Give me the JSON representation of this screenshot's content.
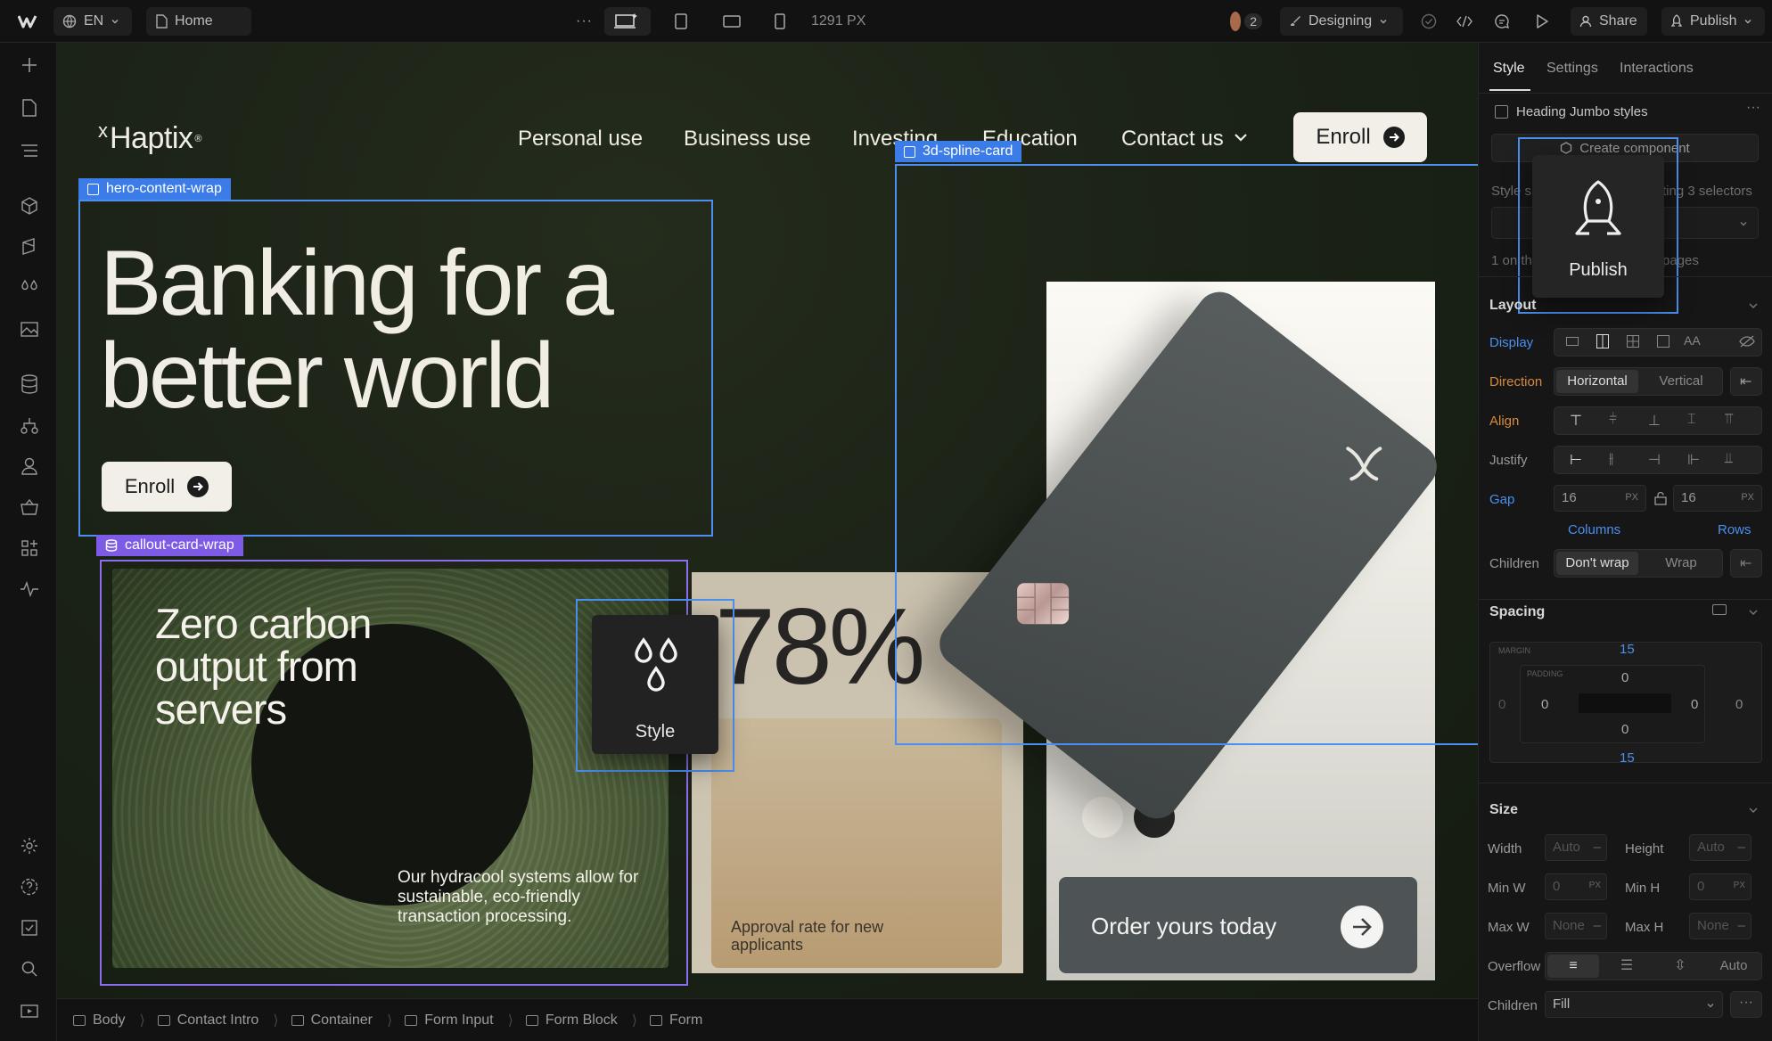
{
  "topbar": {
    "locale": "EN",
    "page": "Home",
    "width_readout": "1291 PX",
    "collaborators": "2",
    "mode": "Designing",
    "share": "Share",
    "publish": "Publish"
  },
  "panel": {
    "tabs": [
      "Style",
      "Settings",
      "Interactions"
    ],
    "style_header": "Heading Jumbo styles",
    "create_component": "Create component",
    "selector_note_left": "Style s",
    "selector_note_right": "ting 3 selectors",
    "on_pages_left": "1 on th",
    "on_pages_right": "pages",
    "publish_popup": "Publish",
    "layout": {
      "title": "Layout",
      "display": "Display",
      "direction": "Direction",
      "dir_h": "Horizontal",
      "dir_v": "Vertical",
      "align": "Align",
      "justify": "Justify",
      "gap": "Gap",
      "gap_col": "16",
      "gap_row": "16",
      "gap_unit": "PX",
      "columns": "Columns",
      "rows": "Rows",
      "children": "Children",
      "dont_wrap": "Don't wrap",
      "wrap": "Wrap"
    },
    "spacing": {
      "title": "Spacing",
      "margin_label": "MARGIN",
      "padding_label": "PADDING",
      "margin_top": "15",
      "margin_bottom": "15",
      "margin_left": "0",
      "margin_right": "0",
      "padding_top": "0",
      "padding_bottom": "0",
      "padding_left": "0",
      "padding_right": "0"
    },
    "size": {
      "title": "Size",
      "width": "Width",
      "height": "Height",
      "auto": "Auto",
      "min_w": "Min W",
      "min_h": "Min H",
      "max_w": "Max W",
      "max_h": "Max H",
      "zero": "0",
      "px": "PX",
      "none": "None",
      "overflow": "Overflow",
      "overflow_auto": "Auto",
      "children": "Children",
      "fill": "Fill"
    }
  },
  "site": {
    "brand": "Haptix",
    "brand_mark": "x",
    "reg": "®",
    "nav": [
      "Personal use",
      "Business use",
      "Investing",
      "Education",
      "Contact us"
    ],
    "enroll": "Enroll",
    "hero_title_1": "Banking for a",
    "hero_title_2": "better world",
    "hero_enroll": "Enroll",
    "callout_title": "Zero carbon output from servers",
    "callout_body": "Our hydracool systems allow for sustainable, eco-friendly transaction processing.",
    "stat_value": "78%",
    "stat_label": "Approval rate for new applicants",
    "order_cta": "Order yours today"
  },
  "canvas_tags": {
    "hero": "hero-content-wrap",
    "callout": "callout-card-wrap",
    "spline": "3d-spline-card",
    "style_popup": "Style"
  },
  "breadcrumbs": [
    "Body",
    "Contact Intro",
    "Container",
    "Form Input",
    "Form Block",
    "Form"
  ],
  "colors": {
    "accent": "#4b8ff0",
    "component": "#8d6cf0",
    "canvas_bg": "#1a2115"
  }
}
